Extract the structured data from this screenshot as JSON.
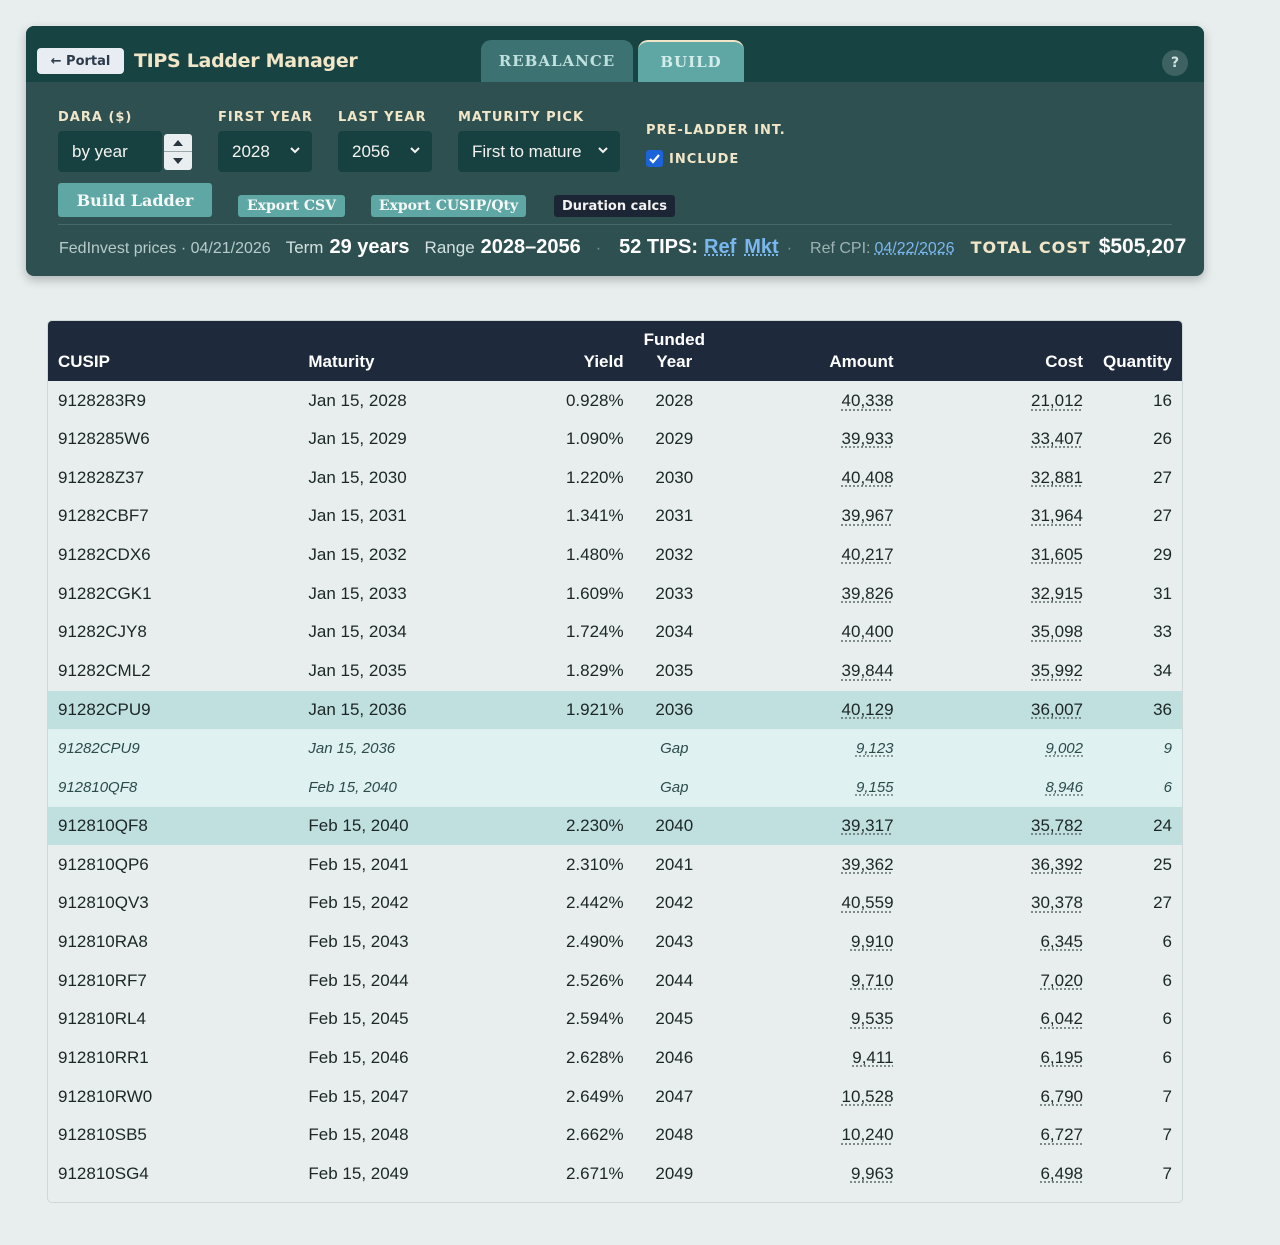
{
  "header": {
    "portal_label": "← Portal",
    "app_title": "TIPS Ladder Manager",
    "tabs": [
      {
        "label": "REBALANCE",
        "active": false
      },
      {
        "label": "BUILD",
        "active": true
      }
    ],
    "help_label": "?"
  },
  "form": {
    "dara": {
      "label": "DARA ($)",
      "value": "by year"
    },
    "first_year": {
      "label": "FIRST YEAR",
      "value": "2028"
    },
    "last_year": {
      "label": "LAST YEAR",
      "value": "2056"
    },
    "maturity_pick": {
      "label": "MATURITY PICK",
      "value": "First to mature"
    },
    "pre_ladder": {
      "label": "PRE-LADDER INT.",
      "checkbox_label": "INCLUDE",
      "checked": true
    }
  },
  "actions": {
    "build": "Build Ladder",
    "export_csv": "Export CSV",
    "export_cusip": "Export CUSIP/Qty",
    "duration": "Duration calcs"
  },
  "status": {
    "prices": "FedInvest prices · 04/21/2026",
    "term_label": "Term",
    "term_value": "29 years",
    "range_label": "Range",
    "range_value": "2028–2056",
    "dot": "·",
    "tips_count": "52 TIPS:",
    "ref_link": "Ref",
    "mkt_link": "Mkt",
    "cpi_label": "Ref CPI:",
    "cpi_value": "04/22/2026",
    "total_label": "TOTAL COST",
    "total_value": "$505,207"
  },
  "colors": {
    "panel": "#2f5050",
    "topbar": "#184343",
    "accent": "#5fa7a4",
    "cream": "#f1e6c8",
    "table_header": "#1e2a3c",
    "highlight_row": "#c0dfdf",
    "gap_row": "#dff1f1",
    "link": "#79b7ee"
  },
  "table": {
    "headers": {
      "cusip": "CUSIP",
      "maturity": "Maturity",
      "yield": "Yield",
      "funded_year": "Funded\nYear",
      "funded_top": "Funded",
      "funded_bottom": "Year",
      "amount": "Amount",
      "cost": "Cost",
      "quantity": "Quantity"
    },
    "rows": [
      {
        "cusip": "9128283R9",
        "maturity": "Jan 15, 2028",
        "yield": "0.928%",
        "year": "2028",
        "amount": "40,338",
        "cost": "21,012",
        "qty": "16",
        "style": ""
      },
      {
        "cusip": "9128285W6",
        "maturity": "Jan 15, 2029",
        "yield": "1.090%",
        "year": "2029",
        "amount": "39,933",
        "cost": "33,407",
        "qty": "26",
        "style": ""
      },
      {
        "cusip": "912828Z37",
        "maturity": "Jan 15, 2030",
        "yield": "1.220%",
        "year": "2030",
        "amount": "40,408",
        "cost": "32,881",
        "qty": "27",
        "style": ""
      },
      {
        "cusip": "91282CBF7",
        "maturity": "Jan 15, 2031",
        "yield": "1.341%",
        "year": "2031",
        "amount": "39,967",
        "cost": "31,964",
        "qty": "27",
        "style": ""
      },
      {
        "cusip": "91282CDX6",
        "maturity": "Jan 15, 2032",
        "yield": "1.480%",
        "year": "2032",
        "amount": "40,217",
        "cost": "31,605",
        "qty": "29",
        "style": ""
      },
      {
        "cusip": "91282CGK1",
        "maturity": "Jan 15, 2033",
        "yield": "1.609%",
        "year": "2033",
        "amount": "39,826",
        "cost": "32,915",
        "qty": "31",
        "style": ""
      },
      {
        "cusip": "91282CJY8",
        "maturity": "Jan 15, 2034",
        "yield": "1.724%",
        "year": "2034",
        "amount": "40,400",
        "cost": "35,098",
        "qty": "33",
        "style": ""
      },
      {
        "cusip": "91282CML2",
        "maturity": "Jan 15, 2035",
        "yield": "1.829%",
        "year": "2035",
        "amount": "39,844",
        "cost": "35,992",
        "qty": "34",
        "style": ""
      },
      {
        "cusip": "91282CPU9",
        "maturity": "Jan 15, 2036",
        "yield": "1.921%",
        "year": "2036",
        "amount": "40,129",
        "cost": "36,007",
        "qty": "36",
        "style": "hl"
      },
      {
        "cusip": "91282CPU9",
        "maturity": "Jan 15, 2036",
        "yield": "",
        "year": "Gap",
        "amount": "9,123",
        "cost": "9,002",
        "qty": "9",
        "style": "gap"
      },
      {
        "cusip": "912810QF8",
        "maturity": "Feb 15, 2040",
        "yield": "",
        "year": "Gap",
        "amount": "9,155",
        "cost": "8,946",
        "qty": "6",
        "style": "gap"
      },
      {
        "cusip": "912810QF8",
        "maturity": "Feb 15, 2040",
        "yield": "2.230%",
        "year": "2040",
        "amount": "39,317",
        "cost": "35,782",
        "qty": "24",
        "style": "hl"
      },
      {
        "cusip": "912810QP6",
        "maturity": "Feb 15, 2041",
        "yield": "2.310%",
        "year": "2041",
        "amount": "39,362",
        "cost": "36,392",
        "qty": "25",
        "style": ""
      },
      {
        "cusip": "912810QV3",
        "maturity": "Feb 15, 2042",
        "yield": "2.442%",
        "year": "2042",
        "amount": "40,559",
        "cost": "30,378",
        "qty": "27",
        "style": ""
      },
      {
        "cusip": "912810RA8",
        "maturity": "Feb 15, 2043",
        "yield": "2.490%",
        "year": "2043",
        "amount": "9,910",
        "cost": "6,345",
        "qty": "6",
        "style": ""
      },
      {
        "cusip": "912810RF7",
        "maturity": "Feb 15, 2044",
        "yield": "2.526%",
        "year": "2044",
        "amount": "9,710",
        "cost": "7,020",
        "qty": "6",
        "style": ""
      },
      {
        "cusip": "912810RL4",
        "maturity": "Feb 15, 2045",
        "yield": "2.594%",
        "year": "2045",
        "amount": "9,535",
        "cost": "6,042",
        "qty": "6",
        "style": ""
      },
      {
        "cusip": "912810RR1",
        "maturity": "Feb 15, 2046",
        "yield": "2.628%",
        "year": "2046",
        "amount": "9,411",
        "cost": "6,195",
        "qty": "6",
        "style": ""
      },
      {
        "cusip": "912810RW0",
        "maturity": "Feb 15, 2047",
        "yield": "2.649%",
        "year": "2047",
        "amount": "10,528",
        "cost": "6,790",
        "qty": "7",
        "style": ""
      },
      {
        "cusip": "912810SB5",
        "maturity": "Feb 15, 2048",
        "yield": "2.662%",
        "year": "2048",
        "amount": "10,240",
        "cost": "6,727",
        "qty": "7",
        "style": ""
      },
      {
        "cusip": "912810SG4",
        "maturity": "Feb 15, 2049",
        "yield": "2.671%",
        "year": "2049",
        "amount": "9,963",
        "cost": "6,498",
        "qty": "7",
        "style": ""
      }
    ]
  }
}
